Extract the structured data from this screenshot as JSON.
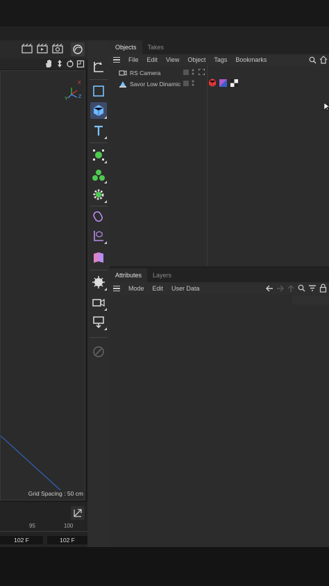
{
  "viewport": {
    "grid_spacing": "Grid Spacing : 50 cm",
    "axis_x": "X",
    "axis_y": "Y",
    "axis_z": "Z"
  },
  "timeline": {
    "tick_95": "95",
    "tick_100": "100",
    "frame_left": "102 F",
    "frame_right": "102 F"
  },
  "objects_panel": {
    "tabs": [
      "Objects",
      "Takes"
    ],
    "menu": [
      "File",
      "Edit",
      "View",
      "Object",
      "Tags",
      "Bookmarks"
    ],
    "items": [
      {
        "name": "RS Camera",
        "icon": "camera-icon"
      },
      {
        "name": "Savor Low Dinamic",
        "icon": "light-icon"
      }
    ]
  },
  "attributes_panel": {
    "tabs": [
      "Attributes",
      "Layers"
    ],
    "menu": [
      "Mode",
      "Edit",
      "User Data"
    ]
  },
  "colors": {
    "accent": "#3d4b6a",
    "cube_blue": "#6fb8ff",
    "green": "#4fc94f",
    "purple": "#b88cf0",
    "tag_red": "#e23a3a"
  }
}
